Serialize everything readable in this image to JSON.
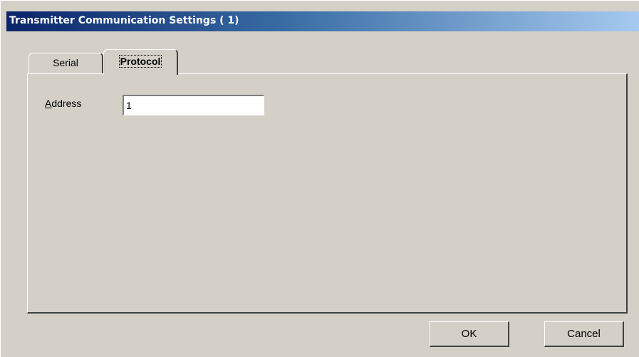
{
  "window": {
    "title": "Transmitter Communication Settings ( 1)"
  },
  "tabs": [
    {
      "label": "Serial",
      "active": false
    },
    {
      "label": "Protocol",
      "active": true
    }
  ],
  "protocol": {
    "address_label_accel": "A",
    "address_label_rest": "ddress",
    "address_value": "1"
  },
  "buttons": {
    "ok": "OK",
    "cancel": "Cancel"
  },
  "colors": {
    "title_gradient_start": "#0a246a",
    "title_gradient_end": "#a6caf0",
    "face": "#d4d0c8"
  }
}
